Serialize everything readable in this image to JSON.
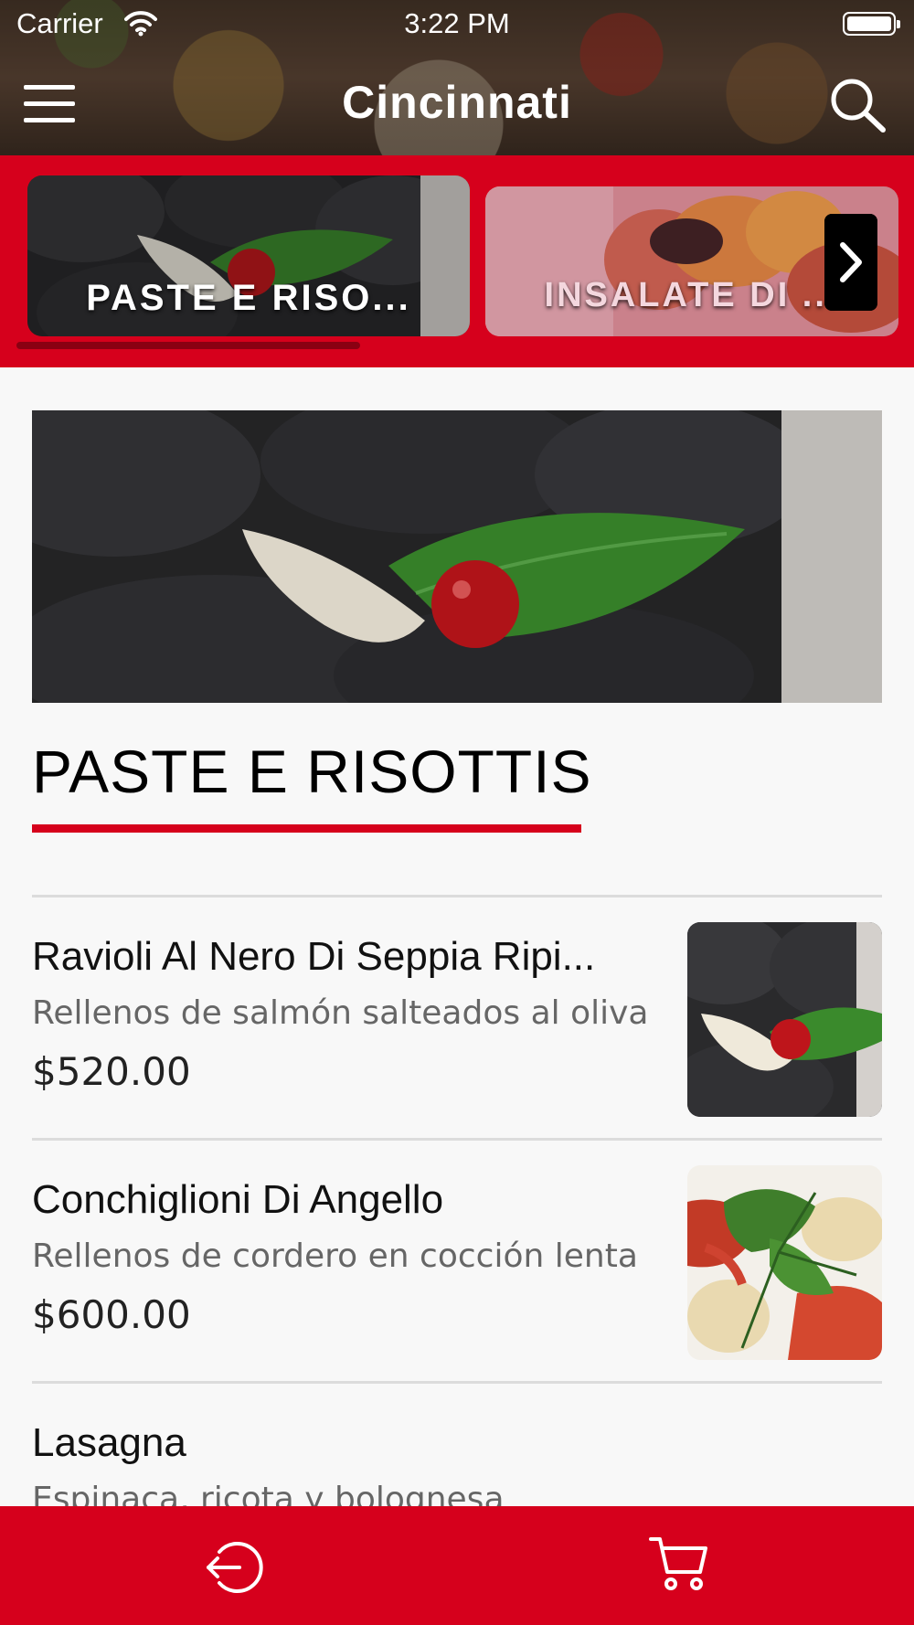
{
  "status_bar": {
    "carrier": "Carrier",
    "time": "3:22 PM"
  },
  "header": {
    "title": "Cincinnati",
    "menu_icon": "hamburger-menu-icon",
    "search_icon": "search-icon"
  },
  "categories": [
    {
      "label": "PASTE E RISO...",
      "selected": true
    },
    {
      "label": "INSALATE DI ...",
      "selected": false
    }
  ],
  "section": {
    "title": "PASTE E RISOTTIS"
  },
  "items": [
    {
      "name": "Ravioli Al Nero Di Seppia Ripi...",
      "description": "Rellenos de salmón salteados al oliva",
      "price": "$520.00"
    },
    {
      "name": "Conchiglioni Di Angello",
      "description": "Rellenos de cordero en cocción lenta",
      "price": "$600.00"
    },
    {
      "name": "Lasagna",
      "description": "Espinaca, ricota y bolognesa",
      "price": ""
    }
  ],
  "bottom_bar": {
    "exit_icon": "exit-icon",
    "cart_icon": "cart-icon"
  },
  "colors": {
    "brand_red": "#d6001c",
    "background": "#f8f8f8",
    "divider": "#dcdcdc"
  }
}
